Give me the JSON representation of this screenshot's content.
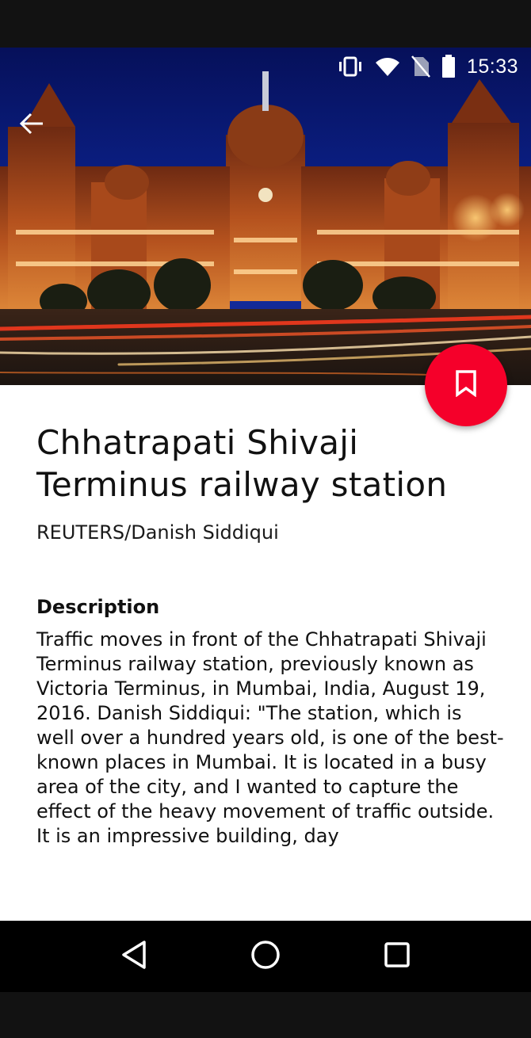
{
  "status_bar": {
    "time": "15:33",
    "icons": [
      "vibrate-icon",
      "wifi-icon",
      "no-sim-icon",
      "battery-icon"
    ]
  },
  "hero": {
    "image_subject": "photo of railway station at night with traffic light trails",
    "back_icon": "arrow-back-icon"
  },
  "fab": {
    "icon": "bookmark-icon",
    "color": "#f5002a"
  },
  "article": {
    "title": "Chhatrapati Shivaji Terminus railway station",
    "credit": "REUTERS/Danish Siddiqui",
    "description_heading": "Description",
    "description": "Traffic moves in front of the Chhatrapati Shivaji Terminus railway station, previously known as Victoria Terminus, in Mumbai, India, August 19, 2016. Danish Siddiqui: \"The station, which is well over a hundred years old, is one of the best-known places in Mumbai. It is located in a busy area of the city, and I wanted to capture the effect of the heavy movement of traffic outside. It is an impressive building, day"
  },
  "nav_bar": {
    "buttons": [
      "back-triangle-icon",
      "home-circle-icon",
      "recents-square-icon"
    ]
  }
}
